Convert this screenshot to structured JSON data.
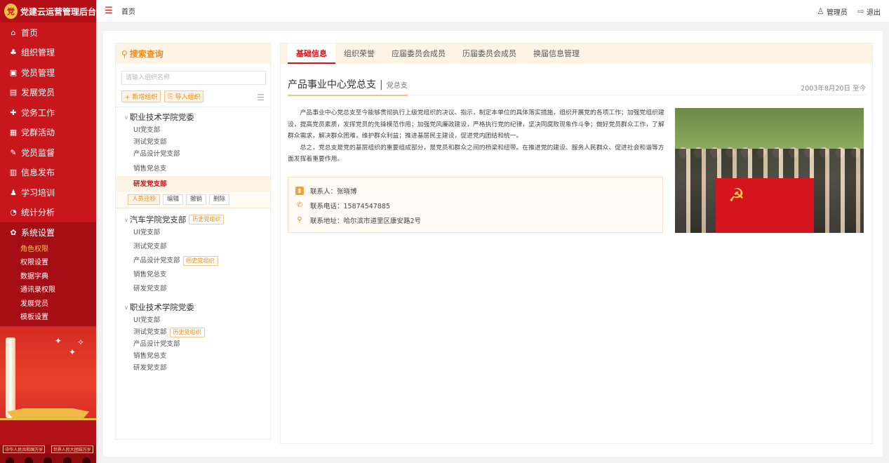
{
  "app": {
    "title": "党建云运营管理后台",
    "logo_text": "党"
  },
  "sidebar": {
    "menu": [
      {
        "label": "首页",
        "icon": "home-icon",
        "glyph": "⌂"
      },
      {
        "label": "组织管理",
        "icon": "org-icon",
        "glyph": "♣"
      },
      {
        "label": "党员管理",
        "icon": "member-card-icon",
        "glyph": "▣"
      },
      {
        "label": "发展党员",
        "icon": "document-icon",
        "glyph": "▤"
      },
      {
        "label": "党务工作",
        "icon": "briefcase-icon",
        "glyph": "✚"
      },
      {
        "label": "党群活动",
        "icon": "calendar-icon",
        "glyph": "▦"
      },
      {
        "label": "党员监督",
        "icon": "edit-icon",
        "glyph": "✎"
      },
      {
        "label": "信息发布",
        "icon": "publish-icon",
        "glyph": "▥"
      },
      {
        "label": "学习培训",
        "icon": "training-icon",
        "glyph": "♟"
      },
      {
        "label": "统计分析",
        "icon": "chart-icon",
        "glyph": "◔"
      },
      {
        "label": "系统设置",
        "icon": "gear-icon",
        "glyph": "✿"
      }
    ],
    "submenu": [
      "角色权限",
      "权限设置",
      "数据字典",
      "通讯录权限",
      "发展党员",
      "模板设置"
    ],
    "banner_texts": [
      "中华人民共和国万岁",
      "世界人民大团结万岁"
    ]
  },
  "topbar": {
    "breadcrumb": "首页",
    "user": "管理员",
    "logout": "退出"
  },
  "left_panel": {
    "title": "搜索查询",
    "search_placeholder": "请输入组织名称",
    "add_button": "+ 新增组织",
    "import_button": "导入组织",
    "groups": [
      {
        "title": "职业技术学院党委",
        "nodes": [
          "UI党支部",
          "测试党支部",
          "产品设计党支部",
          "销售党总支",
          "研发党支部"
        ]
      },
      {
        "title": "汽车学院党支部",
        "tag": "历史党组织",
        "nodes": [
          "UI党支部",
          "测试党支部",
          "产品设计党支部",
          "销售党总支",
          "研发党支部"
        ]
      },
      {
        "title": "职业技术学院党委",
        "nodes": [
          "UI党支部",
          "测试党支部",
          "产品设计党支部",
          "销售党总支",
          "研发党支部"
        ]
      }
    ],
    "history_tag": "历史党组织",
    "node_actions": [
      "人员迁移",
      "编辑",
      "撤销",
      "删除"
    ]
  },
  "right_panel": {
    "tabs": [
      "基础信息",
      "组织荣誉",
      "应届委员会成员",
      "历届委员会成员",
      "换届信息管理"
    ],
    "org_name": "产品事业中心党总支",
    "org_sep": "|",
    "org_type": "党总支",
    "org_date": "2003年8月20日 至今",
    "desc_p1": "产品事业中心党总支至今能够贯彻执行上级党组织的决议、指示，制定本单位的具体落实措施，组织开展党的各项工作；加强党组织建设，提高党员素质，发挥党员的先锋模范作用；加强党风廉政建设，严格执行党的纪律，坚决同腐败现象作斗争；做好党员群众工作，了解群众需求，解决群众困难，维护群众利益；推进基层民主建设，促进党内团结和统一。",
    "desc_p2": "总之，党总支是党的基层组织的重要组成部分，是党员和群众之间的桥梁和纽带。在推进党的建设、服务人民群众、促进社会和谐等方面发挥着重要作用。",
    "contact_person": "联系人：张晓博",
    "contact_phone": "联系电话：15874547885",
    "contact_address": "联系地址：哈尔滨市道里区康安路2号"
  },
  "colors": {
    "primary_red": "#c8161d",
    "accent_orange": "#e98c1a",
    "highlight_yellow": "#f8c24b"
  }
}
